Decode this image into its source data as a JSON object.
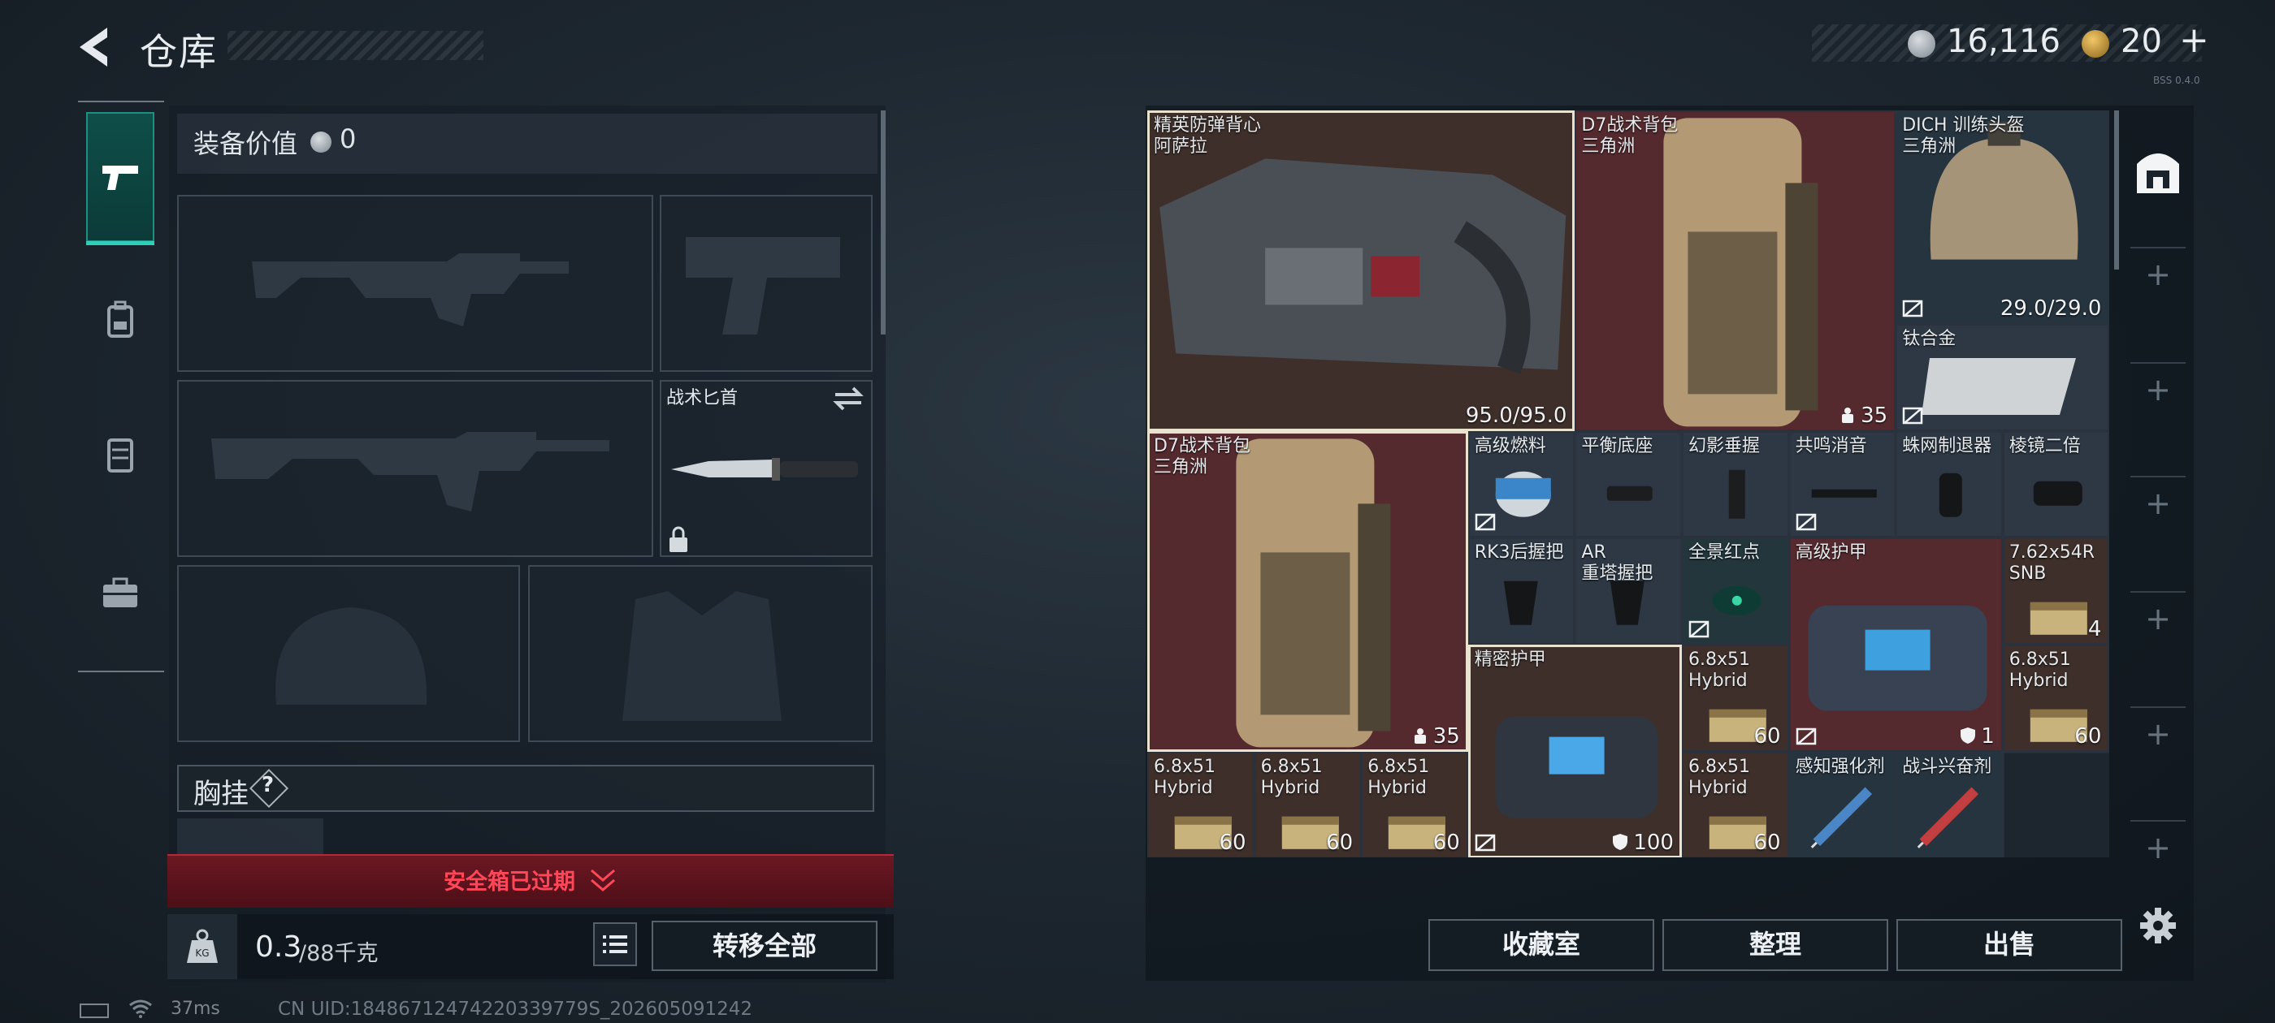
{
  "header": {
    "title": "仓库"
  },
  "currency": {
    "coins": "16,116",
    "tokens": "20",
    "tokens_plus": "+",
    "build": "BSS 0.4.0"
  },
  "equipment": {
    "value_label": "装备价值",
    "value": "0",
    "knife": {
      "label": "战术匕首"
    },
    "chest_rig": {
      "label": "胸挂",
      "help": "?"
    }
  },
  "safe_box": {
    "expired_text": "安全箱已过期"
  },
  "weight": {
    "current": "0.3",
    "max": "/88千克"
  },
  "buttons": {
    "transfer_all": "转移全部",
    "collection": "收藏室",
    "sort": "整理",
    "sell": "出售"
  },
  "status": {
    "ping": "37ms",
    "uid": "CN UID:18486712474220339779S_202605091242"
  },
  "items": [
    {
      "name": "精英防弹背心\n阿萨拉",
      "value": "95.0/95.0",
      "bg": "#3e2f2a"
    },
    {
      "name": "D7战术背包\n三角洲",
      "value": "35",
      "bg": "#552a2f"
    },
    {
      "name": "DICH 训练头盔\n三角洲",
      "value": "29.0/29.0",
      "bg": "#26343f"
    },
    {
      "name": "钛合金",
      "value": "",
      "bg": "#2d3844"
    },
    {
      "name": "D7战术背包\n三角洲",
      "value": "35",
      "bg": "#552a2f"
    },
    {
      "name": "高级燃料",
      "value": "",
      "bg": "#2d3844"
    },
    {
      "name": "平衡底座",
      "value": "",
      "bg": "#2d3844"
    },
    {
      "name": "幻影垂握",
      "value": "",
      "bg": "#2d3844"
    },
    {
      "name": "共鸣消音",
      "value": "",
      "bg": "#2d3844"
    },
    {
      "name": "蛛网制退器",
      "value": "",
      "bg": "#2d3844"
    },
    {
      "name": "棱镜二倍",
      "value": "",
      "bg": "#2d3844"
    },
    {
      "name": "RK3后握把",
      "value": "",
      "bg": "#2d3844"
    },
    {
      "name": "AR\n重塔握把",
      "value": "",
      "bg": "#2d3844"
    },
    {
      "name": "全景红点",
      "value": "",
      "bg": "#22363c"
    },
    {
      "name": "高级护甲",
      "value": "1",
      "bg": "#552a2f"
    },
    {
      "name": "7.62x54R\nSNB",
      "value": "4",
      "bg": "#3e2f2a"
    },
    {
      "name": "精密护甲",
      "value": "100",
      "bg": "#3e2f2a"
    },
    {
      "name": "6.8x51\nHybrid",
      "value": "60",
      "bg": "#3e2f2a"
    },
    {
      "name": "6.8x51\nHybrid",
      "value": "60",
      "bg": "#3e2f2a"
    },
    {
      "name": "6.8x51\nHybrid",
      "value": "60",
      "bg": "#3e2f2a"
    },
    {
      "name": "6.8x51\nHybrid",
      "value": "60",
      "bg": "#3e2f2a"
    },
    {
      "name": "6.8x51\nHybrid",
      "value": "60",
      "bg": "#3e2f2a"
    },
    {
      "name": "6.8x51\nHybrid",
      "value": "60",
      "bg": "#3e2f2a"
    },
    {
      "name": "感知强化剂",
      "value": "",
      "bg": "#26343f"
    },
    {
      "name": "战斗兴奋剂",
      "value": "",
      "bg": "#26343f"
    }
  ]
}
